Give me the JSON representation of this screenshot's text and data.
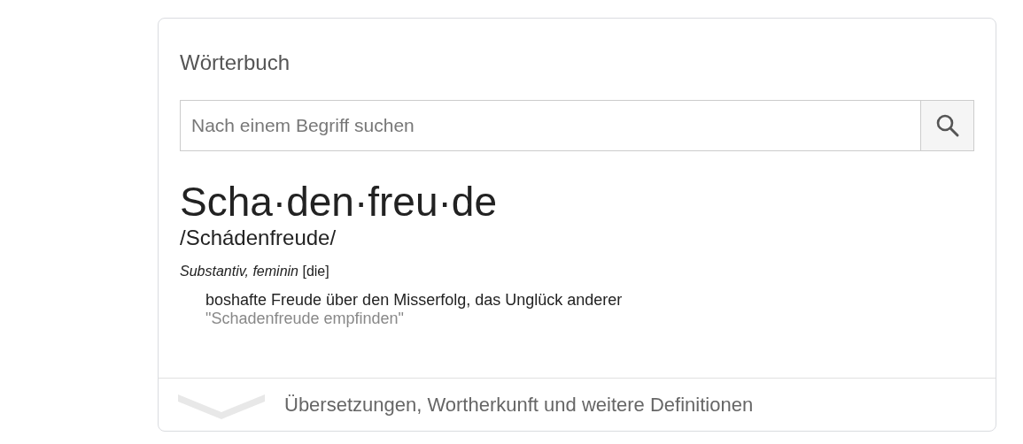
{
  "card": {
    "title": "Wörterbuch",
    "search": {
      "placeholder": "Nach einem Begriff suchen"
    },
    "headword": "Scha·den·freu·de",
    "pronunciation": "/Schádenfreude/",
    "part_of_speech": "*Substantiv, feminin* [die]",
    "definitions": [
      {
        "text": "boshafte Freude über den Misserfolg, das Unglück anderer",
        "example": "\"Schadenfreude empfinden\""
      }
    ],
    "footer": {
      "label": "Übersetzungen, Wortherkunft und weitere Definitionen"
    }
  }
}
